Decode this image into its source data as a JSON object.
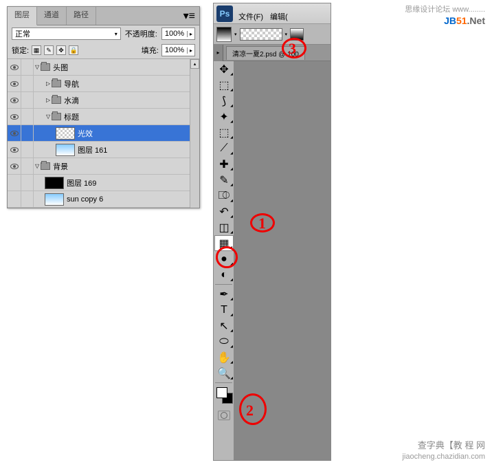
{
  "watermarks": {
    "top": "思缘设计论坛   www........",
    "jb_prefix": "JB",
    "jb_num": "51",
    "jb_suffix": ".Net",
    "bottom_zh": "查字典【教 程 网",
    "bottom_py": "jiaocheng.chazidian.com"
  },
  "layers": {
    "tabs": [
      "图层",
      "通道",
      "路径"
    ],
    "blend_mode": "正常",
    "opacity_label": "不透明度:",
    "opacity_value": "100%",
    "lock_label": "锁定:",
    "fill_label": "填充:",
    "fill_value": "100%",
    "items": [
      {
        "name": "头图",
        "type": "folder",
        "indent": 0,
        "open": true,
        "vis": true
      },
      {
        "name": "导航",
        "type": "folder",
        "indent": 1,
        "open": false,
        "vis": true
      },
      {
        "name": "水滴",
        "type": "folder",
        "indent": 1,
        "open": false,
        "vis": true
      },
      {
        "name": "标题",
        "type": "folder",
        "indent": 1,
        "open": true,
        "vis": true
      },
      {
        "name": "光效",
        "type": "layer",
        "indent": 2,
        "selected": true,
        "vis": true,
        "thumb": "checker"
      },
      {
        "name": "图层 161",
        "type": "layer",
        "indent": 2,
        "vis": true,
        "thumb": "img"
      },
      {
        "name": "背景",
        "type": "folder",
        "indent": 0,
        "open": true,
        "vis": true
      },
      {
        "name": "图层 169",
        "type": "layer",
        "indent": 1,
        "vis": false,
        "thumb": "black"
      },
      {
        "name": "sun copy 6",
        "type": "layer",
        "indent": 1,
        "vis": false,
        "thumb": "img"
      }
    ]
  },
  "ps": {
    "logo": "Ps",
    "menus": [
      "文件(F)",
      "编辑("
    ],
    "doc_tab": "清凉一夏2.psd @ 100",
    "tools": [
      "move",
      "marquee",
      "lasso",
      "wand",
      "crop",
      "eyedropper",
      "heal",
      "brush",
      "stamp",
      "history",
      "eraser",
      "gradient",
      "blur",
      "dodge",
      "pen",
      "type",
      "path",
      "shape",
      "hand",
      "zoom"
    ]
  },
  "annotations": {
    "n1": "1",
    "n2": "2",
    "n3": "3"
  }
}
